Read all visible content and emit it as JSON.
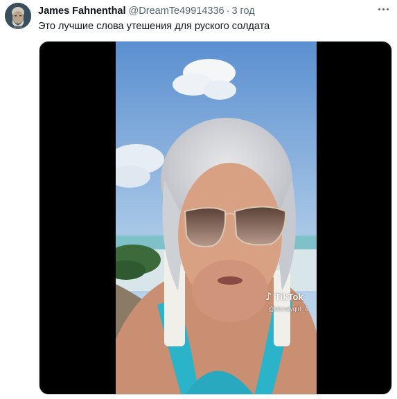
{
  "tweet": {
    "author_name": "James Fahnenthal",
    "author_handle": "@DreamTe49914336",
    "separator": "·",
    "timestamp": "3 год",
    "text": "Это лучшие слова утешения для руского солдата",
    "more_icon": "more-horizontal-icon"
  },
  "media": {
    "type": "video",
    "watermark": {
      "logo_icon": "tiktok-note-icon",
      "brand": "TikTok",
      "username": "@blondygirl_4"
    }
  },
  "colors": {
    "name": "#0f1419",
    "secondary": "#536471",
    "media_background": "#000000"
  }
}
